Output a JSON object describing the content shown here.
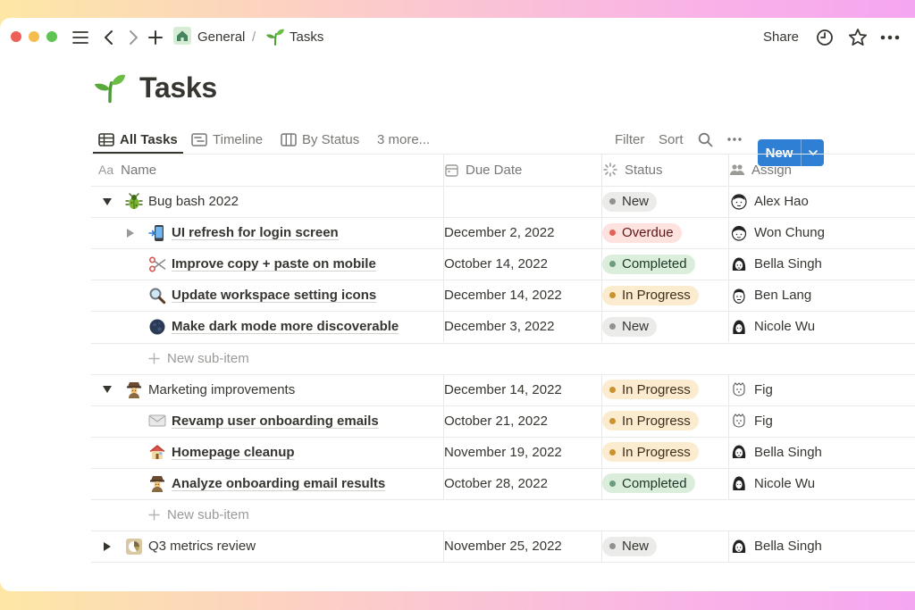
{
  "breadcrumb": {
    "parent": "General",
    "separator": "/",
    "current": "Tasks"
  },
  "topbar": {
    "share_label": "Share"
  },
  "page": {
    "title": "Tasks"
  },
  "views": [
    {
      "label": "All Tasks",
      "icon": "table-icon"
    },
    {
      "label": "Timeline",
      "icon": "timeline-icon"
    },
    {
      "label": "By Status",
      "icon": "board-icon"
    },
    {
      "label": "3 more...",
      "icon": ""
    }
  ],
  "toolbar": {
    "filter": "Filter",
    "sort": "Sort",
    "new_label": "New"
  },
  "columns": {
    "name_icon": "Aa",
    "name": "Name",
    "due": "Due Date",
    "status": "Status",
    "assign": "Assign"
  },
  "status_colors": {
    "New": {
      "bg": "#ebebea",
      "dot": "#91918e",
      "text": "#37352f"
    },
    "Overdue": {
      "bg": "#fde2e0",
      "dot": "#e16259",
      "text": "#5d1715"
    },
    "Completed": {
      "bg": "#dbeddb",
      "dot": "#6c9b7d",
      "text": "#1c3829"
    },
    "In Progress": {
      "bg": "#fbecd0",
      "dot": "#cb912f",
      "text": "#402c1b"
    }
  },
  "rows": [
    {
      "kind": "parent",
      "toggle": "down",
      "icon": "bug-icon",
      "name": "Bug bash 2022",
      "due": "",
      "status": "New",
      "assignee": "Alex Hao"
    },
    {
      "kind": "child",
      "toggle": "right",
      "icon": "phone-icon",
      "name": "UI refresh for login screen",
      "due": "December 2, 2022",
      "status": "Overdue",
      "assignee": "Won Chung"
    },
    {
      "kind": "child",
      "toggle": "",
      "icon": "scissors-icon",
      "name": "Improve copy + paste on mobile",
      "due": "October 14, 2022",
      "status": "Completed",
      "assignee": "Bella Singh"
    },
    {
      "kind": "child",
      "toggle": "",
      "icon": "magnifier-icon",
      "name": "Update workspace setting icons",
      "due": "December 14, 2022",
      "status": "In Progress",
      "assignee": "Ben Lang"
    },
    {
      "kind": "child",
      "toggle": "",
      "icon": "moon-icon",
      "name": "Make dark mode more discoverable",
      "due": "December 3, 2022",
      "status": "New",
      "assignee": "Nicole Wu"
    },
    {
      "kind": "add",
      "label": "New sub-item"
    },
    {
      "kind": "parent",
      "toggle": "down",
      "icon": "detective-icon",
      "name": "Marketing improvements",
      "due": "December 14, 2022",
      "status": "In Progress",
      "assignee": "Fig"
    },
    {
      "kind": "child",
      "toggle": "",
      "icon": "envelope-icon",
      "name": "Revamp user onboarding emails",
      "due": "October 21, 2022",
      "status": "In Progress",
      "assignee": "Fig"
    },
    {
      "kind": "child",
      "toggle": "",
      "icon": "house-icon",
      "name": "Homepage cleanup",
      "due": "November 19, 2022",
      "status": "In Progress",
      "assignee": "Bella Singh"
    },
    {
      "kind": "child",
      "toggle": "",
      "icon": "detective-icon",
      "name": "Analyze onboarding email results",
      "due": "October 28, 2022",
      "status": "Completed",
      "assignee": "Nicole Wu"
    },
    {
      "kind": "add",
      "label": "New sub-item"
    },
    {
      "kind": "parent",
      "toggle": "right",
      "icon": "chart-icon",
      "name": "Q3 metrics review",
      "due": "November 25, 2022",
      "status": "New",
      "assignee": "Bella Singh"
    }
  ]
}
